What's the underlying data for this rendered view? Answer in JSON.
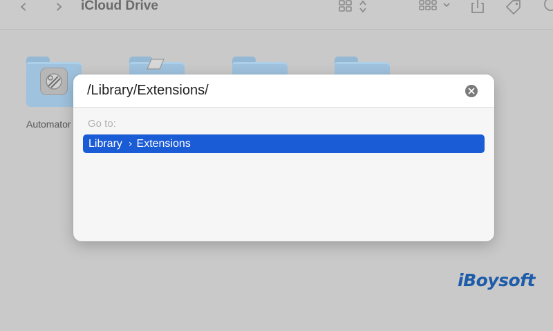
{
  "window": {
    "title": "iCloud Drive",
    "back_icon": "chevron-left-icon",
    "forward_icon": "chevron-right-icon"
  },
  "toolbar": {
    "icons": [
      "view-grid-icon",
      "sort-arrows-icon",
      "group-grid-icon",
      "chevron-down-icon",
      "share-icon",
      "tag-icon",
      "more-icon"
    ]
  },
  "folders": [
    {
      "label": "Automator",
      "badge": "automator-icon"
    },
    {
      "label": ""
    },
    {
      "label": ""
    },
    {
      "label": ""
    }
  ],
  "goto_dialog": {
    "path_value": "/Library/Extensions/",
    "go_to_label": "Go to:",
    "suggestion": {
      "parent": "Library",
      "separator": "›",
      "child": "Extensions"
    },
    "clear_icon": "clear-circle-icon"
  },
  "watermark": {
    "text": "iBoysoft"
  },
  "colors": {
    "selection": "#1a5bd6",
    "folder": "#9fc2de",
    "watermark": "#1e5ba8"
  }
}
